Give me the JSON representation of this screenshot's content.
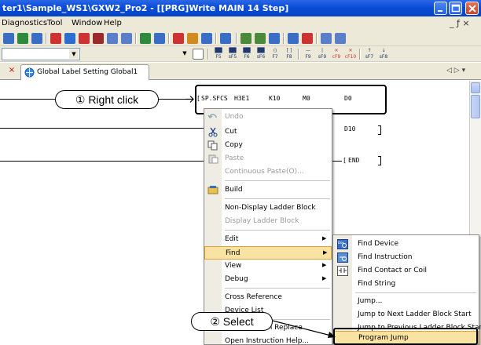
{
  "window": {
    "title": "ter1\\Sample_WS1\\GXW2_Pro2 - [[PRG]Write MAIN 14 Step]"
  },
  "menubar": {
    "items": [
      "Diagnostics",
      "Tool",
      "Window",
      "Help"
    ],
    "mdi_controls": "_ ƒ ×"
  },
  "tab": {
    "label": "Global Label Setting Global1",
    "nav": "◁ ▷ ▾"
  },
  "ladder": {
    "row1": [
      "SP.SFCS",
      "H3E1",
      "K10",
      "M0",
      "D0"
    ],
    "row2": "D10",
    "row3": "END"
  },
  "callouts": {
    "right_click": "① Right click",
    "select": "② Select"
  },
  "context_menu": {
    "items": [
      {
        "label": "Undo",
        "disabled": true
      },
      {
        "label": "Cut",
        "disabled": false
      },
      {
        "label": "Copy",
        "disabled": false
      },
      {
        "label": "Paste",
        "disabled": true
      },
      {
        "label": "Continuous Paste(O)...",
        "disabled": true
      },
      {
        "label": "Build",
        "disabled": false
      },
      {
        "label": "Non-Display Ladder Block",
        "disabled": false
      },
      {
        "label": "Display Ladder Block",
        "disabled": true
      },
      {
        "label": "Edit",
        "disabled": false
      },
      {
        "label": "Find",
        "disabled": false
      },
      {
        "label": "View",
        "disabled": false
      },
      {
        "label": "Debug",
        "disabled": false
      },
      {
        "label": "Cross Reference",
        "disabled": false
      },
      {
        "label": "Device List",
        "disabled": false
      },
      {
        "label": "...h Replace",
        "disabled": false
      },
      {
        "label": "Open Instruction Help...",
        "disabled": false
      }
    ]
  },
  "submenu": {
    "items": [
      "Find Device",
      "Find Instruction",
      "Find Contact or Coil",
      "Find String",
      "Jump...",
      "Jump to Next Ladder Block Start",
      "Jump to Previous Ladder Block Start",
      "Program Jump"
    ]
  },
  "colors": {
    "titlebar": "#0a4cd6",
    "menu_highlight": "#f9e3a3",
    "menu_highlight_border": "#e1a13a"
  }
}
